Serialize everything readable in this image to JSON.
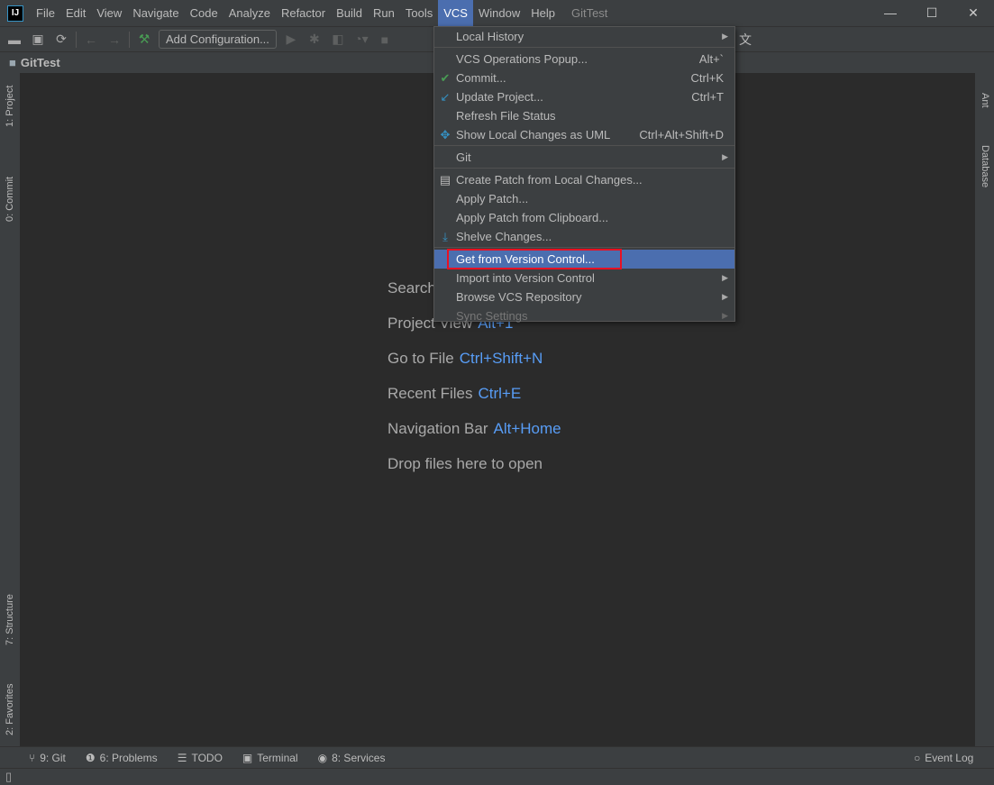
{
  "app": {
    "logo": "IJ",
    "title": "GitTest"
  },
  "menubar": [
    "File",
    "Edit",
    "View",
    "Navigate",
    "Code",
    "Analyze",
    "Refactor",
    "Build",
    "Run",
    "Tools",
    "VCS",
    "Window",
    "Help"
  ],
  "active_menu": "VCS",
  "window_controls": {
    "minimize": "—",
    "maximize": "☐",
    "close": "✕"
  },
  "toolbar": {
    "add_configuration": "Add Configuration..."
  },
  "navbar": {
    "project": "GitTest"
  },
  "left_stripe": {
    "project": "1: Project",
    "commit": "0: Commit",
    "structure": "7: Structure",
    "favorites": "2: Favorites"
  },
  "right_stripe": {
    "ant": "Ant",
    "database": "Database"
  },
  "welcome": [
    {
      "label": "Search",
      "key": ""
    },
    {
      "label": "Project View",
      "key": "Alt+1"
    },
    {
      "label": "Go to File",
      "key": "Ctrl+Shift+N"
    },
    {
      "label": "Recent Files",
      "key": "Ctrl+E"
    },
    {
      "label": "Navigation Bar",
      "key": "Alt+Home"
    },
    {
      "label": "Drop files here to open",
      "key": ""
    }
  ],
  "vcs_menu": {
    "local_history": "Local History",
    "vcs_ops": {
      "label": "VCS Operations Popup...",
      "shortcut": "Alt+`"
    },
    "commit": {
      "label": "Commit...",
      "shortcut": "Ctrl+K"
    },
    "update": {
      "label": "Update Project...",
      "shortcut": "Ctrl+T"
    },
    "refresh": "Refresh File Status",
    "show_uml": {
      "label": "Show Local Changes as UML",
      "shortcut": "Ctrl+Alt+Shift+D"
    },
    "git": "Git",
    "create_patch": "Create Patch from Local Changes...",
    "apply_patch": "Apply Patch...",
    "apply_clipboard": "Apply Patch from Clipboard...",
    "shelve": "Shelve Changes...",
    "get_vc": "Get from Version Control...",
    "import_vc": "Import into Version Control",
    "browse": "Browse VCS Repository",
    "sync": "Sync Settings"
  },
  "bottom_tools": {
    "git": "9: Git",
    "problems": "6: Problems",
    "todo": "TODO",
    "terminal": "Terminal",
    "services": "8: Services",
    "event_log": "Event Log"
  },
  "colors": {
    "highlight": "#4b6eaf",
    "annotation_box": "#e81123",
    "editor_bg": "#2b2b2b"
  }
}
